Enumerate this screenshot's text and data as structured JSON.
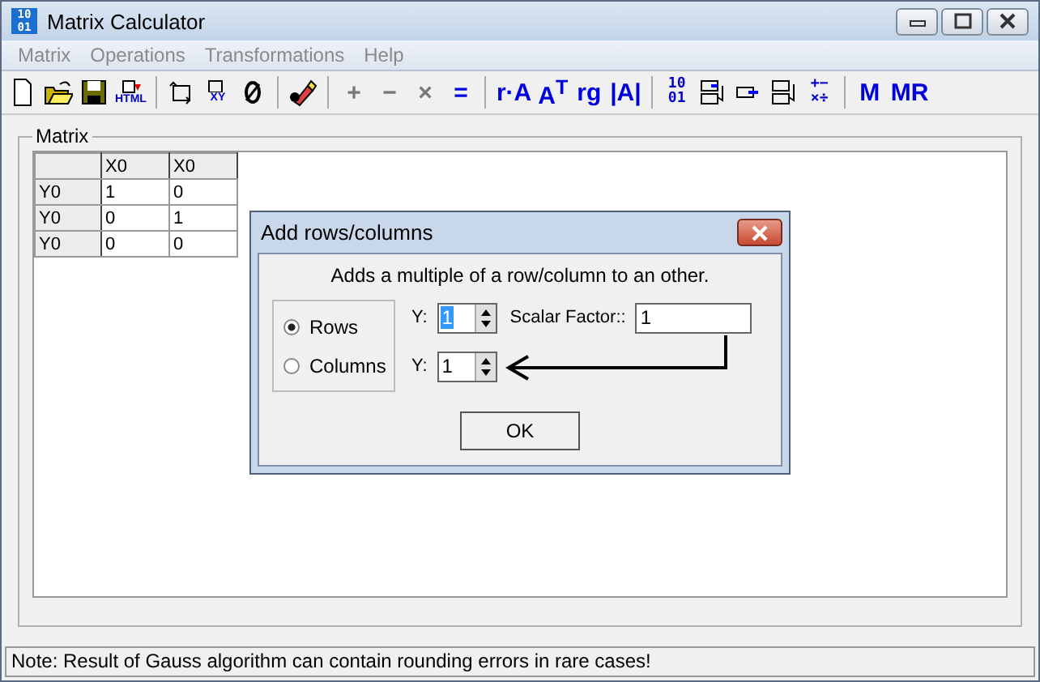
{
  "window": {
    "title": "Matrix Calculator",
    "app_icon": [
      "10",
      "01"
    ]
  },
  "menu": [
    {
      "label": "Matrix",
      "disabled": true
    },
    {
      "label": "Operations",
      "disabled": true
    },
    {
      "label": "Transformations",
      "disabled": true
    },
    {
      "label": "Help",
      "disabled": true
    }
  ],
  "toolbar": [
    {
      "kind": "new",
      "disabled": false
    },
    {
      "kind": "open",
      "disabled": false
    },
    {
      "kind": "save",
      "disabled": false
    },
    {
      "kind": "html",
      "label": "HTML",
      "disabled": false
    },
    {
      "kind": "sep"
    },
    {
      "kind": "rotate",
      "disabled": false
    },
    {
      "kind": "xy",
      "label": "XY",
      "disabled": false
    },
    {
      "kind": "zero",
      "disabled": false
    },
    {
      "kind": "sep"
    },
    {
      "kind": "pen",
      "disabled": false
    },
    {
      "kind": "sep"
    },
    {
      "kind": "text",
      "label": "+",
      "disabled": true
    },
    {
      "kind": "text",
      "label": "−",
      "disabled": true
    },
    {
      "kind": "text",
      "label": "×",
      "disabled": true
    },
    {
      "kind": "text",
      "label": "=",
      "disabled": false
    },
    {
      "kind": "sep"
    },
    {
      "kind": "text",
      "label": "r·A",
      "disabled": false
    },
    {
      "kind": "text",
      "label": "A$^{T}$",
      "disabled": false
    },
    {
      "kind": "text",
      "label": "rg",
      "disabled": false
    },
    {
      "kind": "text",
      "label": "|A|",
      "disabled": false
    },
    {
      "kind": "sep"
    },
    {
      "kind": "stack",
      "lines": [
        "10",
        "01"
      ],
      "disabled": false
    },
    {
      "kind": "rowswap",
      "disabled": false
    },
    {
      "kind": "rowmul",
      "disabled": false
    },
    {
      "kind": "rowadd",
      "disabled": false
    },
    {
      "kind": "stack",
      "lines": [
        "+−",
        "×÷"
      ],
      "disabled": false
    },
    {
      "kind": "sep"
    },
    {
      "kind": "text",
      "label": "M",
      "disabled": false
    },
    {
      "kind": "text",
      "label": "MR",
      "disabled": false
    }
  ],
  "matrix_group": {
    "label": "Matrix",
    "columns": [
      "X0",
      "X0"
    ],
    "rows": [
      {
        "header": "Y0",
        "cells": [
          "1",
          "0"
        ]
      },
      {
        "header": "Y0",
        "cells": [
          "0",
          "1"
        ]
      },
      {
        "header": "Y0",
        "cells": [
          "0",
          "0"
        ]
      }
    ]
  },
  "dialog": {
    "title": "Add rows/columns",
    "description": "Adds a multiple of a row/column to an other.",
    "options": [
      {
        "label": "Rows",
        "selected": true
      },
      {
        "label": "Columns",
        "selected": false
      }
    ],
    "first_spin": {
      "label": "Y:",
      "value": "1",
      "text_selected": true
    },
    "scalar": {
      "label": "Scalar Factor::",
      "value": "1"
    },
    "second_spin": {
      "label": "Y:",
      "value": "1",
      "text_selected": false
    },
    "ok": "OK"
  },
  "status_bar": "Note: Result of Gauss algorithm can contain rounding errors in rare cases!"
}
